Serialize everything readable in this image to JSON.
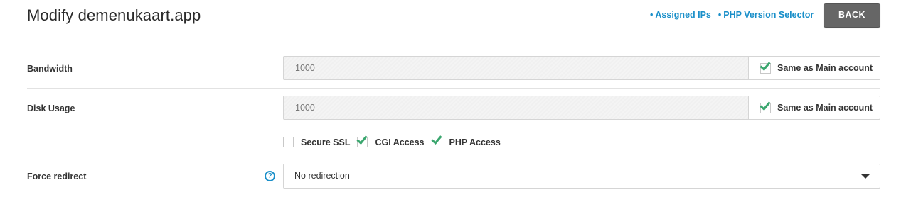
{
  "header": {
    "title": "Modify demenukaart.app",
    "links": [
      {
        "bullet": "•",
        "label": "Assigned IPs"
      },
      {
        "bullet": "•",
        "label": "PHP Version Selector"
      }
    ],
    "back_label": "BACK"
  },
  "form": {
    "bandwidth": {
      "label": "Bandwidth",
      "value": "1000",
      "same_as_main": {
        "label": "Same as Main account",
        "checked": true
      }
    },
    "disk_usage": {
      "label": "Disk Usage",
      "value": "1000",
      "same_as_main": {
        "label": "Same as Main account",
        "checked": true
      }
    },
    "access": [
      {
        "label": "Secure SSL",
        "checked": false
      },
      {
        "label": "CGI Access",
        "checked": true
      },
      {
        "label": "PHP Access",
        "checked": true
      }
    ],
    "force_redirect": {
      "label": "Force redirect",
      "help_icon": "question-circle-icon",
      "help_glyph": "?",
      "selected": "No redirection"
    }
  },
  "colors": {
    "accent_link": "#1a8fc9",
    "check_green": "#3aa66e",
    "back_button": "#666666"
  }
}
